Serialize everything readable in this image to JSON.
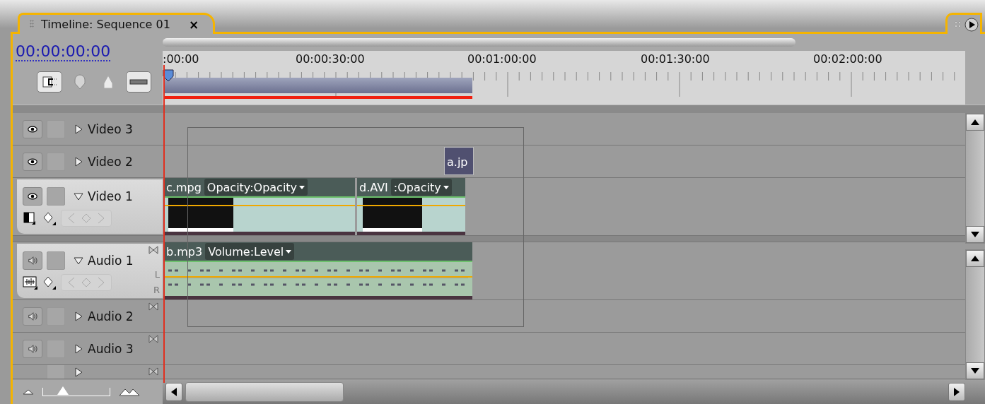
{
  "panel": {
    "tab_title": "Timeline: Sequence 01",
    "close": "×"
  },
  "timecode": "00:00:00:00",
  "ruler": {
    "labels": [
      ":00:00",
      "00:00:30:00",
      "00:01:00:00",
      "00:01:30:00",
      "00:02:00:00"
    ]
  },
  "tracks": [
    {
      "kind": "video",
      "name": "Video 3",
      "expanded": false
    },
    {
      "kind": "video",
      "name": "Video 2",
      "expanded": false,
      "clips": [
        {
          "name": "a.jp"
        }
      ]
    },
    {
      "kind": "video",
      "name": "Video 1",
      "expanded": true,
      "clips": [
        {
          "name": "c.mpg",
          "effect": "Opacity:Opacity"
        },
        {
          "name": "d.AVI",
          "effect": ":Opacity"
        }
      ]
    },
    {
      "kind": "audio",
      "name": "Audio 1",
      "expanded": true,
      "channels": [
        "L",
        "R"
      ],
      "clips": [
        {
          "name": "b.mp3",
          "effect": "Volume:Level"
        }
      ]
    },
    {
      "kind": "audio",
      "name": "Audio 2",
      "expanded": false
    },
    {
      "kind": "audio",
      "name": "Audio 3",
      "expanded": false
    },
    {
      "kind": "master",
      "expanded": false
    }
  ],
  "zoom": {
    "level": 0.3
  }
}
